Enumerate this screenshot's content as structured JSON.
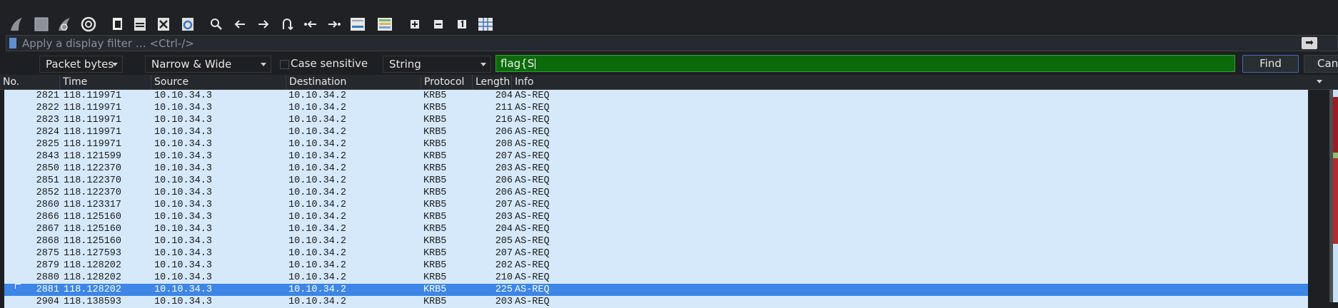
{
  "toolbar": {
    "icons": [
      "shark-fin-start-icon",
      "stop-square-icon",
      "restart-fin-icon",
      "capture-options-gear-icon",
      "open-file-icon",
      "save-file-icon",
      "close-file-icon",
      "reload-file-icon",
      "search-icon",
      "go-back-icon",
      "go-forward-icon",
      "go-to-packet-icon",
      "first-packet-icon",
      "last-packet-icon",
      "autoscroll-icon",
      "colorize-icon",
      "zoom-in-icon",
      "zoom-out-icon",
      "normal-size-icon",
      "resize-columns-icon"
    ]
  },
  "display_filter": {
    "placeholder": "Apply a display filter … <Ctrl-/>",
    "apply_icon": "➡"
  },
  "find_bar": {
    "search_in": "Packet bytes",
    "char_width": "Narrow & Wide",
    "case_sensitive_label": "Case sensitive",
    "search_type": "String",
    "search_value": "flag{S",
    "find_label": "Find",
    "cancel_label": "Cancel"
  },
  "packet_list": {
    "columns": [
      "No.",
      "Time",
      "Source",
      "Destination",
      "Protocol",
      "Length",
      "Info"
    ],
    "rows": [
      {
        "no": "2821",
        "time": "118.119971",
        "src": "10.10.34.3",
        "dst": "10.10.34.2",
        "proto": "KRB5",
        "len": "204",
        "info": "AS-REQ"
      },
      {
        "no": "2822",
        "time": "118.119971",
        "src": "10.10.34.3",
        "dst": "10.10.34.2",
        "proto": "KRB5",
        "len": "211",
        "info": "AS-REQ"
      },
      {
        "no": "2823",
        "time": "118.119971",
        "src": "10.10.34.3",
        "dst": "10.10.34.2",
        "proto": "KRB5",
        "len": "216",
        "info": "AS-REQ"
      },
      {
        "no": "2824",
        "time": "118.119971",
        "src": "10.10.34.3",
        "dst": "10.10.34.2",
        "proto": "KRB5",
        "len": "206",
        "info": "AS-REQ"
      },
      {
        "no": "2825",
        "time": "118.119971",
        "src": "10.10.34.3",
        "dst": "10.10.34.2",
        "proto": "KRB5",
        "len": "208",
        "info": "AS-REQ"
      },
      {
        "no": "2843",
        "time": "118.121599",
        "src": "10.10.34.3",
        "dst": "10.10.34.2",
        "proto": "KRB5",
        "len": "207",
        "info": "AS-REQ"
      },
      {
        "no": "2850",
        "time": "118.122370",
        "src": "10.10.34.3",
        "dst": "10.10.34.2",
        "proto": "KRB5",
        "len": "203",
        "info": "AS-REQ"
      },
      {
        "no": "2851",
        "time": "118.122370",
        "src": "10.10.34.3",
        "dst": "10.10.34.2",
        "proto": "KRB5",
        "len": "206",
        "info": "AS-REQ"
      },
      {
        "no": "2852",
        "time": "118.122370",
        "src": "10.10.34.3",
        "dst": "10.10.34.2",
        "proto": "KRB5",
        "len": "206",
        "info": "AS-REQ"
      },
      {
        "no": "2860",
        "time": "118.123317",
        "src": "10.10.34.3",
        "dst": "10.10.34.2",
        "proto": "KRB5",
        "len": "207",
        "info": "AS-REQ"
      },
      {
        "no": "2866",
        "time": "118.125160",
        "src": "10.10.34.3",
        "dst": "10.10.34.2",
        "proto": "KRB5",
        "len": "203",
        "info": "AS-REQ"
      },
      {
        "no": "2867",
        "time": "118.125160",
        "src": "10.10.34.3",
        "dst": "10.10.34.2",
        "proto": "KRB5",
        "len": "204",
        "info": "AS-REQ"
      },
      {
        "no": "2868",
        "time": "118.125160",
        "src": "10.10.34.3",
        "dst": "10.10.34.2",
        "proto": "KRB5",
        "len": "205",
        "info": "AS-REQ"
      },
      {
        "no": "2875",
        "time": "118.127593",
        "src": "10.10.34.3",
        "dst": "10.10.34.2",
        "proto": "KRB5",
        "len": "207",
        "info": "AS-REQ"
      },
      {
        "no": "2879",
        "time": "118.128202",
        "src": "10.10.34.3",
        "dst": "10.10.34.2",
        "proto": "KRB5",
        "len": "202",
        "info": "AS-REQ"
      },
      {
        "no": "2880",
        "time": "118.128202",
        "src": "10.10.34.3",
        "dst": "10.10.34.2",
        "proto": "KRB5",
        "len": "210",
        "info": "AS-REQ"
      },
      {
        "no": "2881",
        "time": "118.128202",
        "src": "10.10.34.3",
        "dst": "10.10.34.2",
        "proto": "KRB5",
        "len": "225",
        "info": "AS-REQ",
        "selected": true
      },
      {
        "no": "2904",
        "time": "118.138593",
        "src": "10.10.34.3",
        "dst": "10.10.34.2",
        "proto": "KRB5",
        "len": "203",
        "info": "AS-REQ"
      }
    ]
  },
  "colors": {
    "row_bg": "#d6e9fb",
    "selected_bg": "#3d86e8",
    "find_input_bg": "#0b6b0b",
    "window_bg": "#1e1f22"
  }
}
